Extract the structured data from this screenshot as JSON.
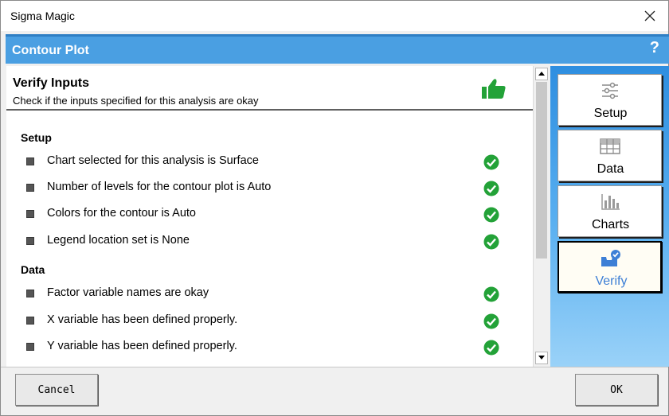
{
  "window": {
    "title": "Sigma Magic"
  },
  "header": {
    "title": "Contour Plot",
    "help": "?"
  },
  "verify": {
    "title": "Verify Inputs",
    "subtitle": "Check if the inputs specified for this analysis are okay"
  },
  "sections": [
    {
      "title": "Setup",
      "items": [
        "Chart selected for this analysis is Surface",
        "Number of levels for the contour plot is Auto",
        "Colors for the contour is Auto",
        "Legend location set is None"
      ]
    },
    {
      "title": "Data",
      "items": [
        "Factor variable names are okay",
        "X variable has been defined properly.",
        "Y variable has been defined properly."
      ]
    }
  ],
  "nav": [
    {
      "label": "Setup",
      "icon": "sliders-icon"
    },
    {
      "label": "Data",
      "icon": "grid-icon"
    },
    {
      "label": "Charts",
      "icon": "bar-chart-icon"
    },
    {
      "label": "Verify",
      "icon": "inbox-check-icon"
    }
  ],
  "buttons": {
    "cancel": "Cancel",
    "ok": "OK"
  },
  "colors": {
    "header": "#4a9fe2",
    "check": "#23a238",
    "active_label": "#3d7fd6"
  }
}
